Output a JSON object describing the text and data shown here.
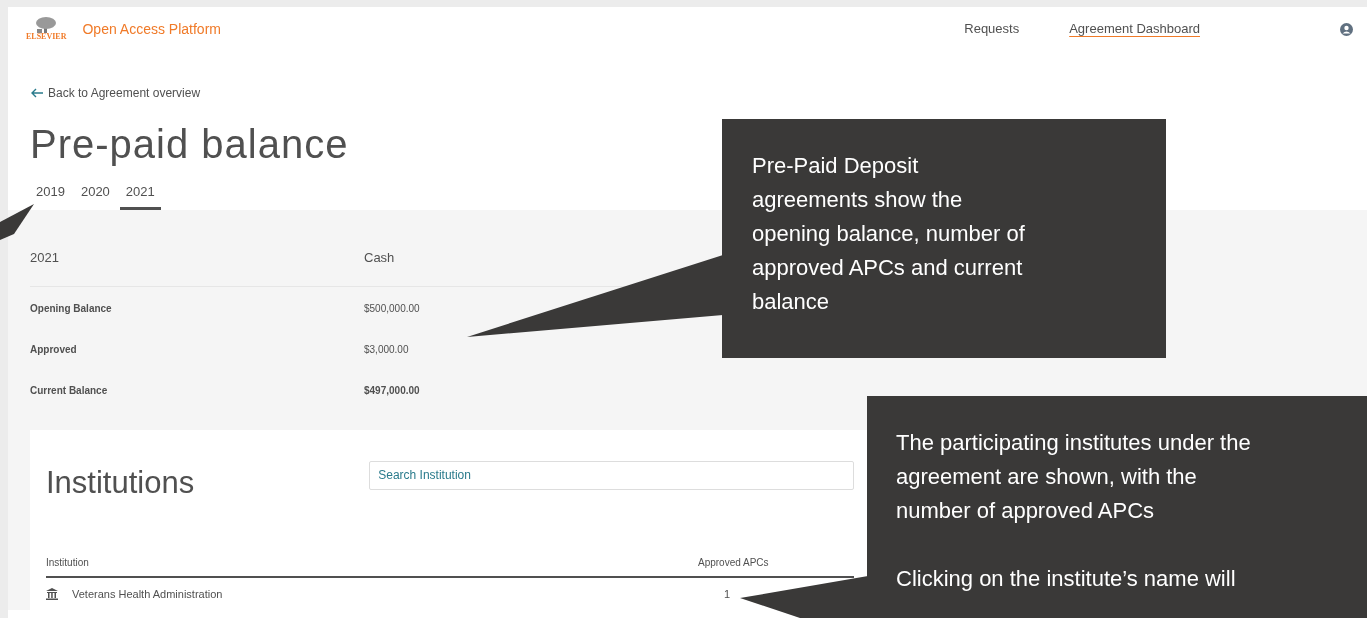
{
  "header": {
    "logo_text": "ELSEVIER",
    "brand": "Open Access Platform",
    "nav": [
      {
        "label": "Requests",
        "selected": false
      },
      {
        "label": "Agreement Dashboard",
        "selected": true
      }
    ]
  },
  "back_link": "Back to Agreement overview",
  "title": "Pre-paid balance",
  "year_tabs": [
    {
      "label": "2019",
      "selected": false
    },
    {
      "label": "2020",
      "selected": false
    },
    {
      "label": "2021",
      "selected": true
    }
  ],
  "balance": {
    "year": "2021",
    "type": "Cash",
    "rows": [
      {
        "label": "Opening Balance",
        "value": "$500,000.00",
        "emphasized": false
      },
      {
        "label": "Approved",
        "value": "$3,000.00",
        "emphasized": false
      },
      {
        "label": "Current Balance",
        "value": "$497,000.00",
        "emphasized": true
      }
    ]
  },
  "institutions": {
    "title": "Institutions",
    "search": {
      "placeholder": "Search Institution"
    },
    "columns": [
      "Institution",
      "Approved APCs"
    ],
    "rows": [
      {
        "name": "Veterans Health Administration",
        "approved_apcs": "1"
      }
    ]
  },
  "callouts": [
    {
      "paragraphs": [
        [
          "Pre-Paid Deposit",
          "agreements show the",
          "opening balance, number of",
          "approved APCs and current",
          "balance"
        ]
      ]
    },
    {
      "paragraphs": [
        [
          "The participating institutes under the",
          "agreement are shown, with the",
          "number of approved APCs"
        ],
        [
          "Clicking on the institute’s name will"
        ]
      ]
    }
  ]
}
